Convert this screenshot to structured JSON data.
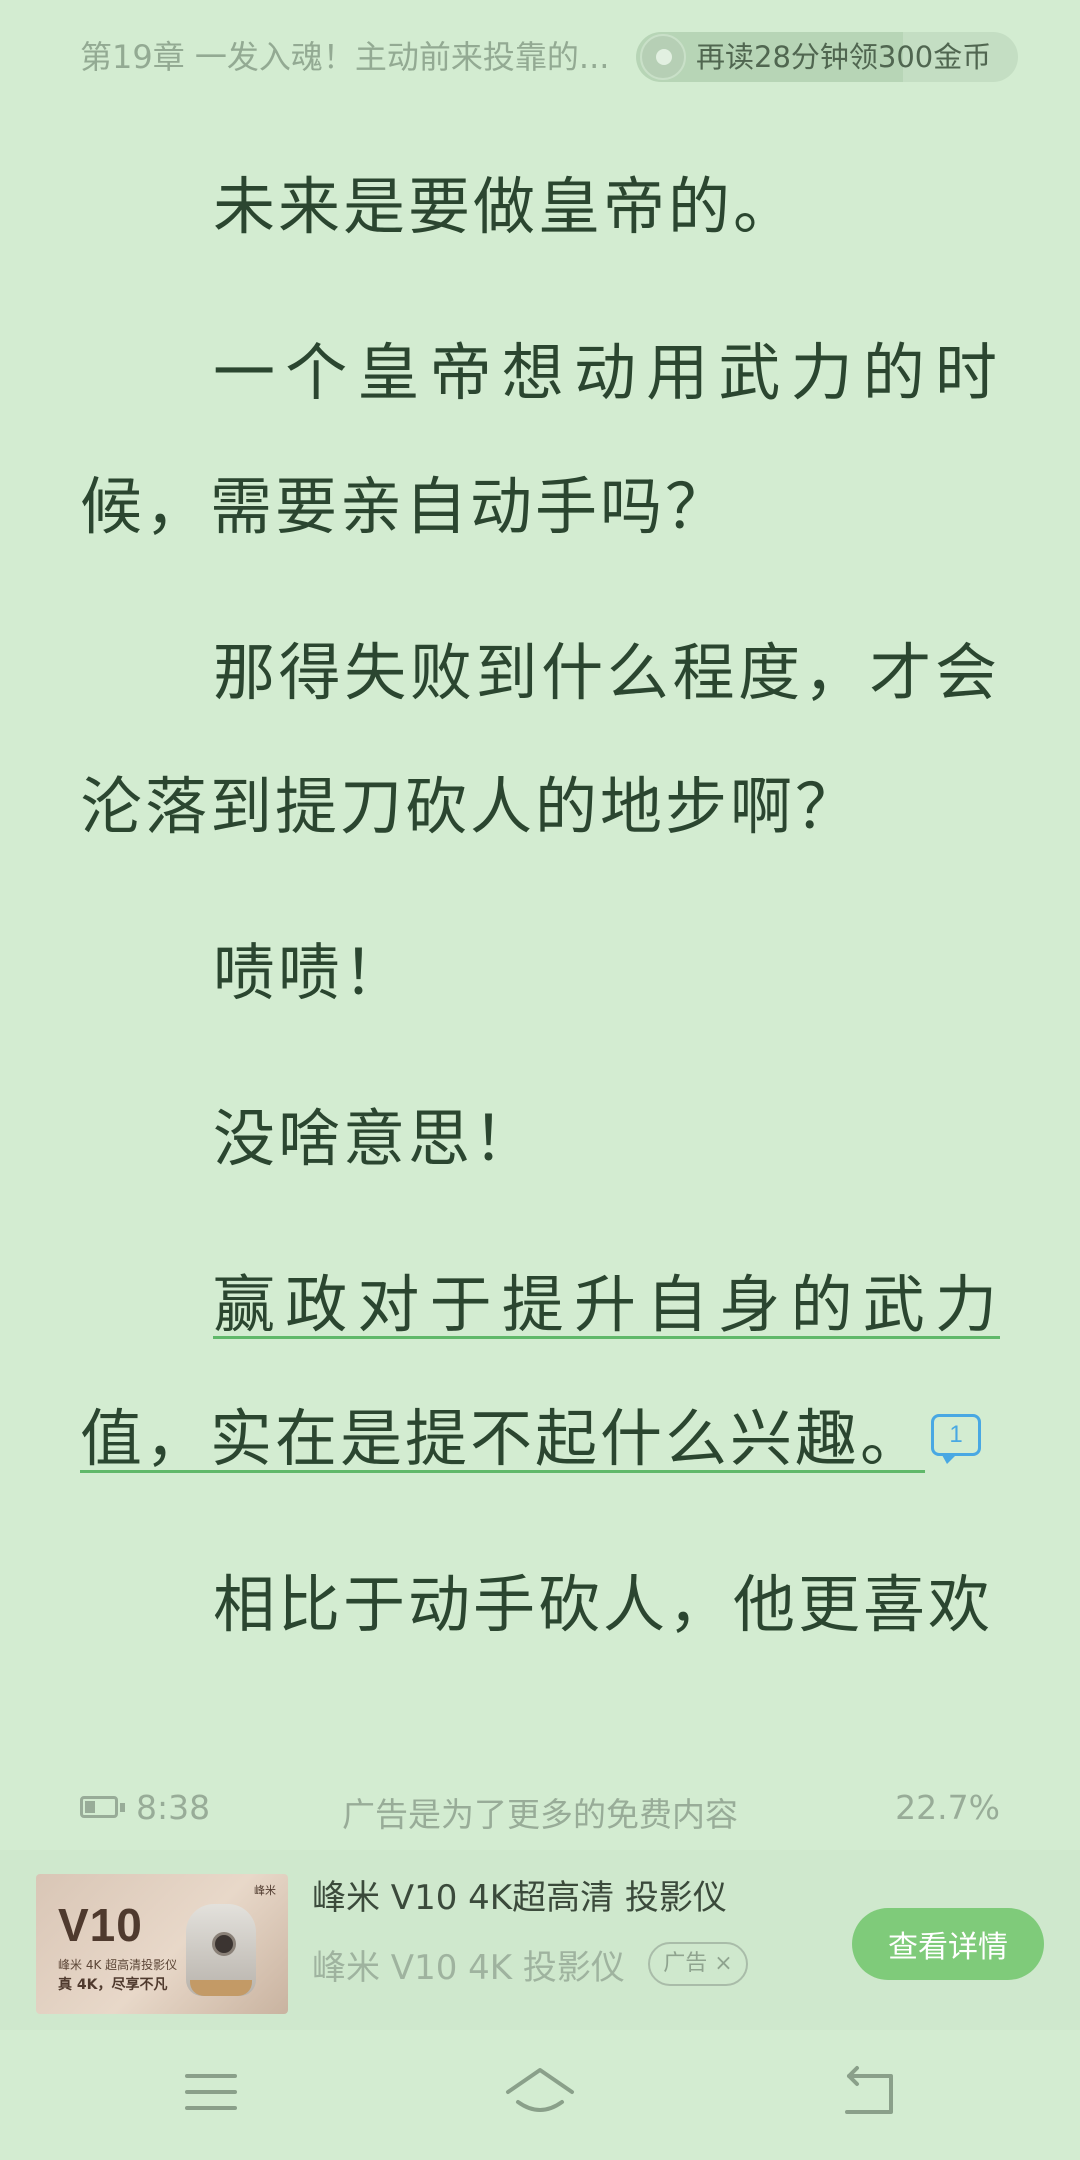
{
  "header": {
    "chapter_title": "第19章 一发入魂！主动前来投靠的...",
    "reward_text": "再读28分钟领300金币",
    "reward_icon": "coin-timer-icon"
  },
  "content": {
    "paragraphs": [
      "未来是要做皇帝的。",
      "一个皇帝想动用武力的时候，需要亲自动手吗？",
      "那得失败到什么程度，才会沦落到提刀砍人的地步啊？",
      "啧啧！",
      "没啥意思！",
      "赢政对于提升自身的武力值，实在是提不起什么兴趣。",
      "相比于动手砍人，他更喜欢"
    ],
    "comment_count": "1",
    "highlight_color": "#60b86a"
  },
  "status": {
    "time": "8:38",
    "ad_note": "广告是为了更多的免费内容",
    "progress_percent": "22.7%",
    "battery_icon": "battery-icon"
  },
  "ad": {
    "title": "峰米 V10 4K超高清 投影仪",
    "description": "峰米 V10 4K 投影仪",
    "tag": "广告 ×",
    "button_label": "查看详情",
    "image": {
      "brand": "峰米",
      "headline": "V10",
      "subline": "峰米 4K 超高清投影仪",
      "slogan": "真 4K，尽享不凡"
    }
  },
  "nav": {
    "menu_icon": "menu-icon",
    "home_icon": "home-icon",
    "back_icon": "back-icon"
  },
  "colors": {
    "background": "#d3ecd1",
    "text": "#2b4630",
    "button": "#7fcb7a",
    "comment_badge": "#49a8e3"
  }
}
